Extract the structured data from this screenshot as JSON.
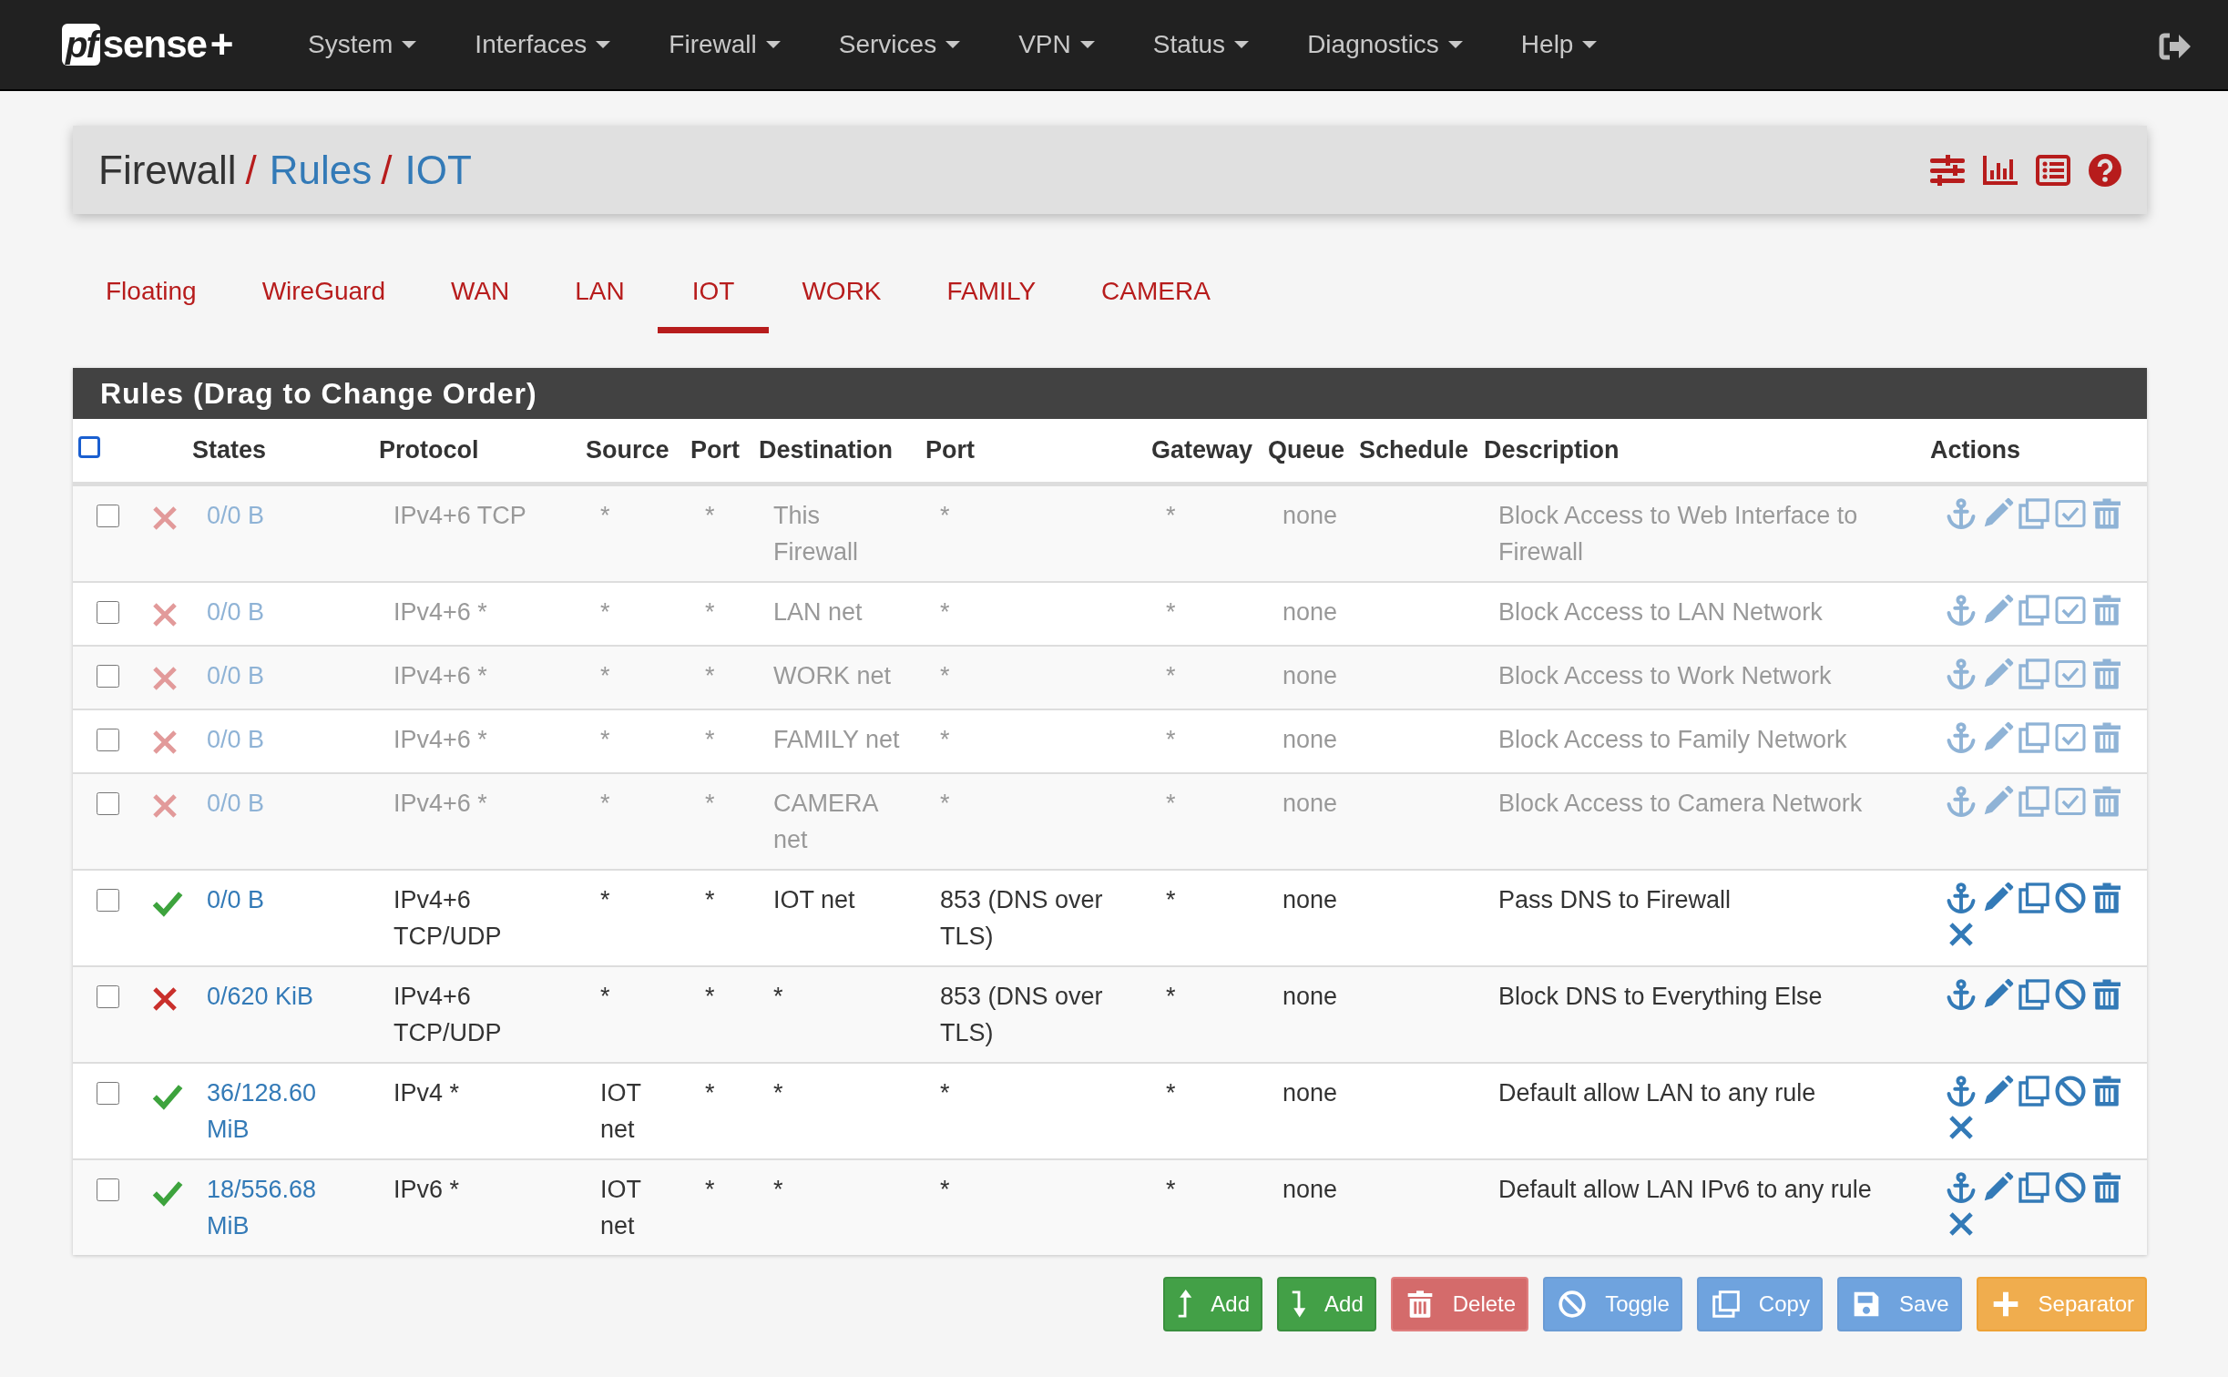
{
  "navbar": {
    "logo_box": "pf",
    "logo_text": "sense",
    "logo_plus": "+",
    "menus": [
      "System",
      "Interfaces",
      "Firewall",
      "Services",
      "VPN",
      "Status",
      "Diagnostics",
      "Help"
    ]
  },
  "breadcrumb": [
    {
      "label": "Firewall",
      "link": false
    },
    {
      "separator": "/",
      "label": "Rules",
      "link": true
    },
    {
      "separator": "/",
      "label": "IOT",
      "link": true
    }
  ],
  "tabs": [
    {
      "label": "Floating",
      "selected": false
    },
    {
      "label": "WireGuard",
      "selected": false
    },
    {
      "label": "WAN",
      "selected": false
    },
    {
      "label": "LAN",
      "selected": false
    },
    {
      "label": "IOT",
      "selected": true
    },
    {
      "label": "WORK",
      "selected": false
    },
    {
      "label": "FAMILY",
      "selected": false
    },
    {
      "label": "CAMERA",
      "selected": false
    }
  ],
  "panel_title": "Rules (Drag to Change Order)",
  "table": {
    "select_all_checked": false,
    "columns": [
      "States",
      "Protocol",
      "Source",
      "Port",
      "Destination",
      "Port",
      "Gateway",
      "Queue",
      "Schedule",
      "Description",
      "Actions"
    ],
    "rows": [
      {
        "selected": false,
        "disabled": true,
        "pass": false,
        "states": "0/0 B",
        "protocol": "IPv4+6 TCP",
        "source": "*",
        "source_port": "*",
        "destination": "This Firewall",
        "destination_port": "*",
        "gateway": "*",
        "queue": "none",
        "description": "Block Access to Web Interface to Firewall",
        "kill_states_icon": false
      },
      {
        "selected": false,
        "disabled": true,
        "pass": false,
        "states": "0/0 B",
        "protocol": "IPv4+6 *",
        "source": "*",
        "source_port": "*",
        "destination": "LAN net",
        "destination_port": "*",
        "gateway": "*",
        "queue": "none",
        "description": "Block Access to LAN Network",
        "kill_states_icon": false
      },
      {
        "selected": false,
        "disabled": true,
        "pass": false,
        "states": "0/0 B",
        "protocol": "IPv4+6 *",
        "source": "*",
        "source_port": "*",
        "destination": "WORK net",
        "destination_port": "*",
        "gateway": "*",
        "queue": "none",
        "description": "Block Access to Work Network",
        "kill_states_icon": false
      },
      {
        "selected": false,
        "disabled": true,
        "pass": false,
        "states": "0/0 B",
        "protocol": "IPv4+6 *",
        "source": "*",
        "source_port": "*",
        "destination": "FAMILY net",
        "destination_port": "*",
        "gateway": "*",
        "queue": "none",
        "description": "Block Access to Family Network",
        "kill_states_icon": false
      },
      {
        "selected": false,
        "disabled": true,
        "pass": false,
        "states": "0/0 B",
        "protocol": "IPv4+6 *",
        "source": "*",
        "source_port": "*",
        "destination": "CAMERA net",
        "destination_port": "*",
        "gateway": "*",
        "queue": "none",
        "description": "Block Access to Camera Network",
        "kill_states_icon": false
      },
      {
        "selected": false,
        "disabled": false,
        "pass": true,
        "states": "0/0 B",
        "protocol": "IPv4+6 TCP/UDP",
        "source": "*",
        "source_port": "*",
        "destination": "IOT net",
        "destination_port": "853 (DNS over TLS)",
        "gateway": "*",
        "queue": "none",
        "description": "Pass DNS to Firewall",
        "kill_states_icon": true
      },
      {
        "selected": false,
        "disabled": false,
        "pass": false,
        "states": "0/620 KiB",
        "protocol": "IPv4+6 TCP/UDP",
        "source": "*",
        "source_port": "*",
        "destination": "*",
        "destination_port": "853 (DNS over TLS)",
        "gateway": "*",
        "queue": "none",
        "description": "Block DNS to Everything Else",
        "kill_states_icon": false
      },
      {
        "selected": false,
        "disabled": false,
        "pass": true,
        "states": "36/128.60 MiB",
        "protocol": "IPv4 *",
        "source": "IOT net",
        "source_port": "*",
        "destination": "*",
        "destination_port": "*",
        "gateway": "*",
        "queue": "none",
        "description": "Default allow LAN to any rule",
        "kill_states_icon": true
      },
      {
        "selected": false,
        "disabled": false,
        "pass": true,
        "states": "18/556.68 MiB",
        "protocol": "IPv6 *",
        "source": "IOT net",
        "source_port": "*",
        "destination": "*",
        "destination_port": "*",
        "gateway": "*",
        "queue": "none",
        "description": "Default allow LAN IPv6 to any rule",
        "kill_states_icon": true
      }
    ]
  },
  "buttons": [
    {
      "label": "Add",
      "kind": "add-top"
    },
    {
      "label": "Add",
      "kind": "add-bottom"
    },
    {
      "label": "Delete",
      "kind": "delete"
    },
    {
      "label": "Toggle",
      "kind": "toggle"
    },
    {
      "label": "Copy",
      "kind": "copy"
    },
    {
      "label": "Save",
      "kind": "save"
    },
    {
      "label": "Separator",
      "kind": "separator"
    }
  ]
}
